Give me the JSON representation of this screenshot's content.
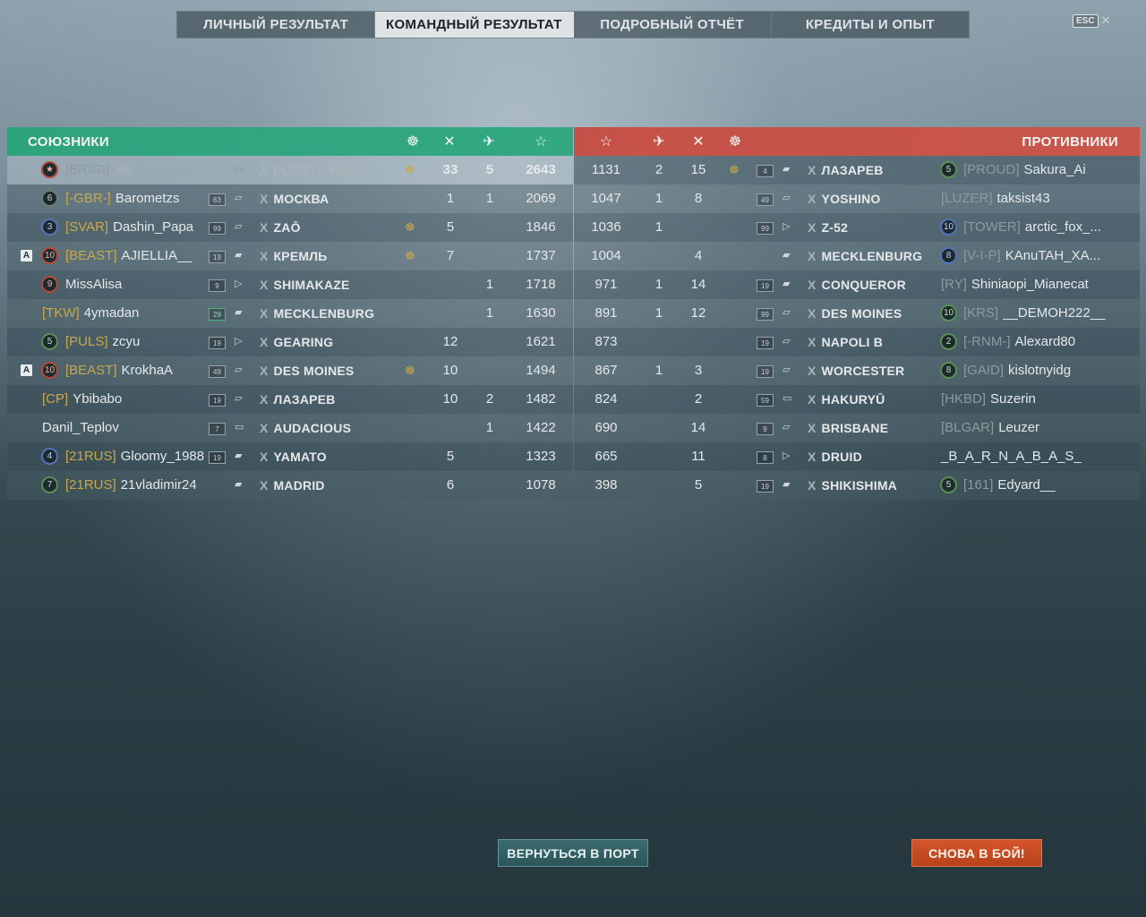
{
  "tabs": [
    {
      "label": "ЛИЧНЫЙ РЕЗУЛЬТАТ",
      "active": false
    },
    {
      "label": "КОМАНДНЫЙ РЕЗУЛЬТАТ",
      "active": true
    },
    {
      "label": "ПОДРОБНЫЙ ОТЧЁТ",
      "active": false
    },
    {
      "label": "КРЕДИТЫ И ОПЫТ",
      "active": false
    }
  ],
  "esc": {
    "key": "ESC",
    "close": "✕"
  },
  "allies": {
    "title": "СОЮЗНИКИ",
    "header_icons": [
      "medal-icon",
      "kills-icon",
      "planes-icon",
      "xp-star-icon"
    ],
    "rows": [
      {
        "division": "",
        "karma": "★",
        "karma_color": "red",
        "clan": "[BRIGI]",
        "name": "3ip",
        "level": "",
        "level_color": "",
        "ship_icon": "carrier",
        "tier": "X",
        "ship": "PUERTO RICO",
        "medal": true,
        "kills": "33",
        "planes": "5",
        "xp": "2643",
        "me": true
      },
      {
        "division": "",
        "karma": "6",
        "karma_color": "",
        "clan": "[-GBR-]",
        "name": "Barometzs",
        "level": "63",
        "level_color": "",
        "ship_icon": "cruiser",
        "tier": "X",
        "ship": "МОСКВА",
        "medal": false,
        "kills": "1",
        "planes": "1",
        "xp": "2069",
        "me": false
      },
      {
        "division": "",
        "karma": "3",
        "karma_color": "blue",
        "clan": "[SVAR]",
        "name": "Dashin_Papa",
        "level": "99",
        "level_color": "",
        "ship_icon": "cruiser",
        "tier": "X",
        "ship": "ZAŌ",
        "medal": true,
        "kills": "5",
        "planes": "",
        "xp": "1846",
        "me": false
      },
      {
        "division": "A",
        "karma": "10",
        "karma_color": "red",
        "clan": "[BEAST]",
        "name": "AJIELLIA__",
        "level": "19",
        "level_color": "",
        "ship_icon": "battleship",
        "tier": "X",
        "ship": "КРЕМЛЬ",
        "medal": true,
        "kills": "7",
        "planes": "",
        "xp": "1737",
        "me": false
      },
      {
        "division": "",
        "karma": "9",
        "karma_color": "red",
        "clan": "",
        "name": "MissAlisa",
        "level": "9",
        "level_color": "",
        "ship_icon": "destroyer",
        "tier": "X",
        "ship": "SHIMAKAZE",
        "medal": false,
        "kills": "",
        "planes": "1",
        "xp": "1718",
        "me": false
      },
      {
        "division": "",
        "karma": "",
        "karma_color": "",
        "clan": "[TKW]",
        "name": "4ymadan",
        "level": "29",
        "level_color": "green",
        "ship_icon": "battleship",
        "tier": "X",
        "ship": "MECKLENBURG",
        "medal": false,
        "kills": "",
        "planes": "1",
        "xp": "1630",
        "me": false
      },
      {
        "division": "",
        "karma": "5",
        "karma_color": "green",
        "clan": "[PULS]",
        "name": "zcyu",
        "level": "19",
        "level_color": "",
        "ship_icon": "destroyer",
        "tier": "X",
        "ship": "GEARING",
        "medal": false,
        "kills": "12",
        "planes": "",
        "xp": "1621",
        "me": false
      },
      {
        "division": "A",
        "karma": "10",
        "karma_color": "red",
        "clan": "[BEAST]",
        "name": "KrokhaA",
        "level": "49",
        "level_color": "",
        "ship_icon": "cruiser",
        "tier": "X",
        "ship": "DES MOINES",
        "medal": true,
        "kills": "10",
        "planes": "",
        "xp": "1494",
        "me": false
      },
      {
        "division": "",
        "karma": "",
        "karma_color": "",
        "clan": "[CP]",
        "name": "Ybibabo",
        "level": "19",
        "level_color": "",
        "ship_icon": "cruiser",
        "tier": "X",
        "ship": "ЛАЗАРЕВ",
        "medal": false,
        "kills": "10",
        "planes": "2",
        "xp": "1482",
        "me": false
      },
      {
        "division": "",
        "karma": "",
        "karma_color": "",
        "clan": "",
        "name": "Danil_Teplov",
        "level": "7",
        "level_color": "",
        "ship_icon": "carrier",
        "tier": "X",
        "ship": "AUDACIOUS",
        "medal": false,
        "kills": "",
        "planes": "1",
        "xp": "1422",
        "me": false
      },
      {
        "division": "",
        "karma": "4",
        "karma_color": "blue",
        "clan": "[21RUS]",
        "name": "Gloomy_1988",
        "level": "19",
        "level_color": "",
        "ship_icon": "battleship",
        "tier": "X",
        "ship": "YAMATO",
        "medal": false,
        "kills": "5",
        "planes": "",
        "xp": "1323",
        "me": false
      },
      {
        "division": "",
        "karma": "7",
        "karma_color": "green",
        "clan": "[21RUS]",
        "name": "21vladimir24",
        "level": "",
        "level_color": "",
        "ship_icon": "battleship",
        "tier": "X",
        "ship": "MADRID",
        "medal": false,
        "kills": "6",
        "planes": "",
        "xp": "1078",
        "me": false
      }
    ]
  },
  "enemies": {
    "title": "ПРОТИВНИКИ",
    "header_icons": [
      "xp-star-icon",
      "planes-icon",
      "kills-icon",
      "medal-icon"
    ],
    "rows": [
      {
        "xp": "1131",
        "planes": "2",
        "kills": "15",
        "medal": true,
        "level": "4",
        "ship_icon": "battleship",
        "tier": "X",
        "ship": "ЛАЗАРЕВ",
        "karma": "5",
        "karma_color": "green",
        "clan": "[PROUD]",
        "name": "Sakura_Ai"
      },
      {
        "xp": "1047",
        "planes": "1",
        "kills": "8",
        "medal": false,
        "level": "49",
        "ship_icon": "cruiser",
        "tier": "X",
        "ship": "YOSHINO",
        "karma": "",
        "karma_color": "",
        "clan": "[LUZER]",
        "name": "taksist43"
      },
      {
        "xp": "1036",
        "planes": "1",
        "kills": "",
        "medal": false,
        "level": "99",
        "ship_icon": "destroyer",
        "tier": "X",
        "ship": "Z-52",
        "karma": "10",
        "karma_color": "blue",
        "clan": "[TOWER]",
        "name": "arctic_fox_..."
      },
      {
        "xp": "1004",
        "planes": "",
        "kills": "4",
        "medal": false,
        "level": "",
        "ship_icon": "battleship",
        "tier": "X",
        "ship": "MECKLENBURG",
        "karma": "8",
        "karma_color": "blue",
        "clan": "[V-I-P]",
        "name": "KAnuTAH_XA..."
      },
      {
        "xp": "971",
        "planes": "1",
        "kills": "14",
        "medal": false,
        "level": "19",
        "ship_icon": "battleship",
        "tier": "X",
        "ship": "CONQUEROR",
        "karma": "",
        "karma_color": "",
        "clan": "[RY]",
        "name": "Shiniaopi_Mianecat"
      },
      {
        "xp": "891",
        "planes": "1",
        "kills": "12",
        "medal": false,
        "level": "99",
        "ship_icon": "cruiser",
        "tier": "X",
        "ship": "DES MOINES",
        "karma": "10",
        "karma_color": "green",
        "clan": "[KRS]",
        "name": "__DEMOH222__"
      },
      {
        "xp": "873",
        "planes": "",
        "kills": "",
        "medal": false,
        "level": "19",
        "ship_icon": "cruiser",
        "tier": "X",
        "ship": "NAPOLI B",
        "karma": "2",
        "karma_color": "green",
        "clan": "[-RNM-]",
        "name": "Alexard80"
      },
      {
        "xp": "867",
        "planes": "1",
        "kills": "3",
        "medal": false,
        "level": "19",
        "ship_icon": "cruiser",
        "tier": "X",
        "ship": "WORCESTER",
        "karma": "8",
        "karma_color": "green",
        "clan": "[GAID]",
        "name": "kislotnyidg"
      },
      {
        "xp": "824",
        "planes": "",
        "kills": "2",
        "medal": false,
        "level": "59",
        "ship_icon": "carrier",
        "tier": "X",
        "ship": "HAKURYŪ",
        "karma": "",
        "karma_color": "",
        "clan": "[HKBD]",
        "name": "Suzerin"
      },
      {
        "xp": "690",
        "planes": "",
        "kills": "14",
        "medal": false,
        "level": "9",
        "ship_icon": "cruiser",
        "tier": "X",
        "ship": "BRISBANE",
        "karma": "",
        "karma_color": "",
        "clan": "[BLGAR]",
        "name": "Leuzer"
      },
      {
        "xp": "665",
        "planes": "",
        "kills": "11",
        "medal": false,
        "level": "8",
        "ship_icon": "destroyer",
        "tier": "X",
        "ship": "DRUID",
        "karma": "",
        "karma_color": "",
        "clan": "",
        "name": "_B_A_R_N_A_B_A_S_"
      },
      {
        "xp": "398",
        "planes": "",
        "kills": "5",
        "medal": false,
        "level": "19",
        "ship_icon": "battleship",
        "tier": "X",
        "ship": "SHIKISHIMA",
        "karma": "5",
        "karma_color": "green",
        "clan": "[161]",
        "name": "Edyard__"
      }
    ]
  },
  "buttons": {
    "port": "ВЕРНУТЬСЯ В ПОРТ",
    "fight": "СНОВА В БОЙ!"
  },
  "colors": {
    "allies_header": "#2fa37c",
    "enemies_header": "#c55248",
    "fight_button": "#c8491f",
    "port_button": "#336166"
  }
}
